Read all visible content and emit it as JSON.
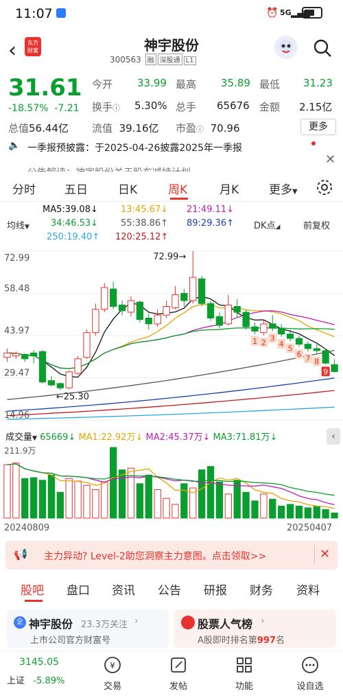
{
  "status": {
    "time": "11:07",
    "signal": "5G",
    "battery": "49"
  },
  "header": {
    "logo_text_1": "东方",
    "logo_text_2": "财富",
    "title": "神宇股份",
    "code": "300563",
    "tags": [
      "融",
      "深股通",
      "L1"
    ]
  },
  "quote": {
    "price": "31.61",
    "change_pct": "-18.57%",
    "change_amt": "-7.21",
    "fields": [
      {
        "label": "今开",
        "value": "33.99",
        "color": "green"
      },
      {
        "label": "最高",
        "value": "35.89",
        "color": "green"
      },
      {
        "label": "最低",
        "value": "31.23",
        "color": "green"
      },
      {
        "label": "换手",
        "value": "5.30%",
        "color": "black"
      },
      {
        "label": "总手",
        "value": "65676",
        "color": "black"
      },
      {
        "label": "金额",
        "value": "2.15亿",
        "color": "black"
      }
    ],
    "mkt_cap_label": "总值",
    "mkt_cap": "56.44亿",
    "float_label": "流值",
    "float_cap": "39.16亿",
    "pe_label": "市盈",
    "pe_value": "70.96",
    "more_label": "更多"
  },
  "notice": {
    "text": "一季报预披露：于2025-04-26披露2025年一季报",
    "peek_text": "公告解读：神宇股份关于股东减持计划"
  },
  "tabs": [
    "分时",
    "五日",
    "日K",
    "周K",
    "月K",
    "更多"
  ],
  "active_tab": "周K",
  "ma": {
    "row1": [
      "MA5:39.08↓",
      "13:45.67↓",
      "21:49.11↓"
    ],
    "row2": [
      "34:46.53↓",
      "55:38.86↑",
      "89:29.36↑"
    ],
    "row3": [
      "250:19.40↑",
      "120:25.12↑"
    ],
    "colors": [
      "#111111",
      "#e8a400",
      "#c41ab5",
      "#0a9e2f",
      "#555555",
      "#1a3fb5",
      "#2aa6e8",
      "#c41a1a"
    ],
    "indicator_label": "均线",
    "dk_label": "DK点",
    "adjust_label": "前复权"
  },
  "price_axis": [
    "72.99",
    "58.48",
    "43.97",
    "29.47",
    "14.96"
  ],
  "annotations": {
    "high": "72.99",
    "low": "25.30"
  },
  "dk_numbers": [
    "1",
    "2",
    "3",
    "4",
    "5",
    "6",
    "7",
    "8",
    "9"
  ],
  "volume": {
    "label": "成交量",
    "current": "65669↓",
    "ma1": "MA1:22.92万↓",
    "ma2": "MA2:45.37万↓",
    "ma3": "MA3:71.81万↓",
    "max_label": "211.9万",
    "start_date": "20240809",
    "end_date": "20250407"
  },
  "chart_data": {
    "type": "candlestick",
    "ylim": [
      14.96,
      72.99
    ],
    "candles": [
      {
        "o": 36.5,
        "c": 38.0,
        "h": 39.5,
        "l": 35.0
      },
      {
        "o": 37.0,
        "c": 37.8,
        "h": 38.5,
        "l": 36.0
      },
      {
        "o": 37.5,
        "c": 36.0,
        "h": 38.0,
        "l": 35.0
      },
      {
        "o": 38.0,
        "c": 37.0,
        "h": 39.0,
        "l": 34.5
      },
      {
        "o": 38.5,
        "c": 28.0,
        "h": 39.0,
        "l": 27.5
      },
      {
        "o": 28.5,
        "c": 27.0,
        "h": 30.0,
        "l": 26.5
      },
      {
        "o": 27.5,
        "c": 26.0,
        "h": 28.0,
        "l": 25.3
      },
      {
        "o": 26.0,
        "c": 31.5,
        "h": 32.0,
        "l": 25.5
      },
      {
        "o": 31.0,
        "c": 36.0,
        "h": 37.0,
        "l": 30.5
      },
      {
        "o": 36.5,
        "c": 45.0,
        "h": 46.0,
        "l": 36.0
      },
      {
        "o": 45.0,
        "c": 53.0,
        "h": 55.0,
        "l": 44.0
      },
      {
        "o": 53.0,
        "c": 60.5,
        "h": 62.0,
        "l": 52.0
      },
      {
        "o": 60.0,
        "c": 54.0,
        "h": 62.5,
        "l": 53.0
      },
      {
        "o": 54.5,
        "c": 52.5,
        "h": 56.0,
        "l": 51.0
      },
      {
        "o": 52.0,
        "c": 56.0,
        "h": 57.5,
        "l": 50.5
      },
      {
        "o": 55.5,
        "c": 49.5,
        "h": 56.0,
        "l": 48.5
      },
      {
        "o": 50.0,
        "c": 48.0,
        "h": 51.5,
        "l": 46.0
      },
      {
        "o": 48.0,
        "c": 51.0,
        "h": 53.0,
        "l": 47.0
      },
      {
        "o": 51.0,
        "c": 54.0,
        "h": 56.0,
        "l": 50.0
      },
      {
        "o": 53.5,
        "c": 58.0,
        "h": 61.0,
        "l": 53.0
      },
      {
        "o": 58.5,
        "c": 56.0,
        "h": 60.0,
        "l": 54.0
      },
      {
        "o": 56.0,
        "c": 64.0,
        "h": 72.99,
        "l": 55.0
      },
      {
        "o": 63.5,
        "c": 55.0,
        "h": 64.5,
        "l": 54.0
      },
      {
        "o": 55.0,
        "c": 50.0,
        "h": 56.0,
        "l": 49.0
      },
      {
        "o": 50.5,
        "c": 47.5,
        "h": 52.0,
        "l": 46.5
      },
      {
        "o": 48.0,
        "c": 54.5,
        "h": 58.0,
        "l": 47.5
      },
      {
        "o": 54.0,
        "c": 52.0,
        "h": 56.5,
        "l": 50.0
      },
      {
        "o": 52.0,
        "c": 47.0,
        "h": 53.0,
        "l": 46.0
      },
      {
        "o": 47.0,
        "c": 45.5,
        "h": 48.5,
        "l": 44.5
      },
      {
        "o": 45.0,
        "c": 48.0,
        "h": 49.5,
        "l": 44.0
      },
      {
        "o": 48.0,
        "c": 46.5,
        "h": 51.0,
        "l": 45.5
      },
      {
        "o": 46.5,
        "c": 44.5,
        "h": 48.0,
        "l": 43.5
      },
      {
        "o": 44.5,
        "c": 43.0,
        "h": 46.0,
        "l": 42.0
      },
      {
        "o": 43.0,
        "c": 41.0,
        "h": 44.0,
        "l": 40.0
      },
      {
        "o": 41.0,
        "c": 39.5,
        "h": 42.0,
        "l": 38.5
      },
      {
        "o": 39.5,
        "c": 38.8,
        "h": 41.0,
        "l": 37.5
      },
      {
        "o": 38.8,
        "c": 34.5,
        "h": 39.5,
        "l": 34.0
      },
      {
        "o": 34.0,
        "c": 31.6,
        "h": 35.9,
        "l": 31.2
      }
    ],
    "volumes": [
      62,
      64,
      46,
      47,
      44,
      50,
      30,
      46,
      43,
      38,
      33,
      42,
      82,
      56,
      58,
      40,
      50,
      33,
      23,
      16,
      40,
      35,
      56,
      60,
      42,
      28,
      44,
      30,
      20,
      28,
      22,
      14,
      16,
      14,
      12,
      14,
      10,
      6
    ],
    "vol_max": 211.9
  },
  "banner": {
    "text": "主力异动? Level-2助您洞察主力意图。点击领取>>"
  },
  "subtabs": [
    "股吧",
    "盘口",
    "资讯",
    "公告",
    "研报",
    "财务",
    "资料"
  ],
  "active_subtab": "股吧",
  "cards": {
    "left_title": "神宇股份",
    "left_follow": "23.3万关注",
    "left_sub": "上市公司官方财富号",
    "right_title": "股票人气榜",
    "right_sub_pre": "A股即时排名第",
    "right_rank": "997",
    "right_sub_post": "名"
  },
  "bottom": {
    "index_value": "3145.05",
    "index_name": "上证",
    "index_change": "-5.89%",
    "nav": [
      "交易",
      "发帖",
      "功能",
      "设自选"
    ]
  }
}
